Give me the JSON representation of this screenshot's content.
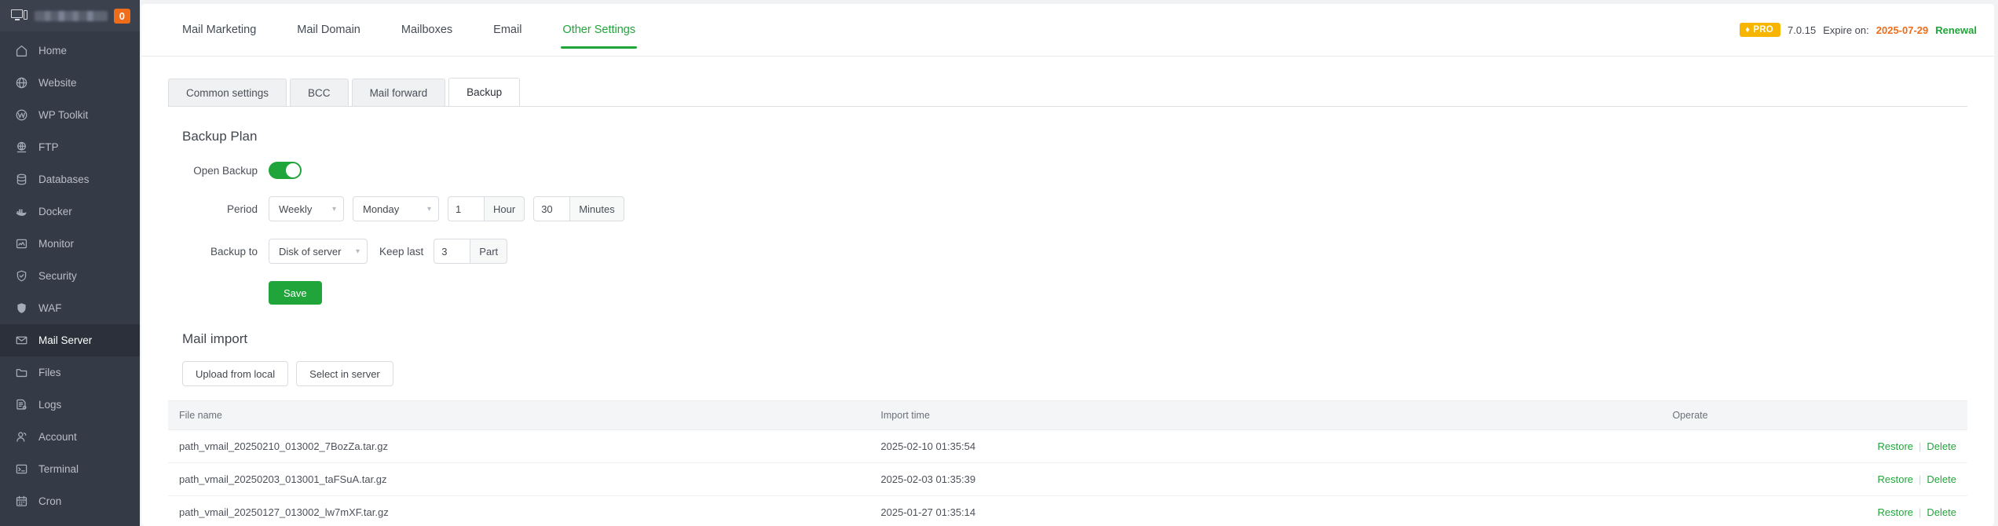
{
  "sidebar": {
    "badge": "0",
    "items": [
      {
        "label": "Home",
        "icon": "home-icon",
        "active": false
      },
      {
        "label": "Website",
        "icon": "globe-icon",
        "active": false
      },
      {
        "label": "WP Toolkit",
        "icon": "wordpress-icon",
        "active": false
      },
      {
        "label": "FTP",
        "icon": "ftp-globe-icon",
        "active": false
      },
      {
        "label": "Databases",
        "icon": "database-icon",
        "active": false
      },
      {
        "label": "Docker",
        "icon": "docker-icon",
        "active": false
      },
      {
        "label": "Monitor",
        "icon": "monitor-chart-icon",
        "active": false
      },
      {
        "label": "Security",
        "icon": "shield-check-icon",
        "active": false
      },
      {
        "label": "WAF",
        "icon": "shield-icon",
        "active": false
      },
      {
        "label": "Mail Server",
        "icon": "envelope-icon",
        "active": true
      },
      {
        "label": "Files",
        "icon": "folder-icon",
        "active": false
      },
      {
        "label": "Logs",
        "icon": "logs-icon",
        "active": false
      },
      {
        "label": "Account",
        "icon": "user-icon",
        "active": false
      },
      {
        "label": "Terminal",
        "icon": "terminal-icon",
        "active": false
      },
      {
        "label": "Cron",
        "icon": "calendar-icon",
        "active": false
      }
    ]
  },
  "topbar": {
    "tabs": [
      {
        "label": "Mail Marketing",
        "active": false
      },
      {
        "label": "Mail Domain",
        "active": false
      },
      {
        "label": "Mailboxes",
        "active": false
      },
      {
        "label": "Email",
        "active": false
      },
      {
        "label": "Other Settings",
        "active": true
      }
    ],
    "pro_label": "PRO",
    "pro_icon": "gem-icon",
    "version": "7.0.15",
    "expire_label": "Expire on:",
    "expire_date": "2025-07-29",
    "renewal_label": "Renewal"
  },
  "subtabs": [
    {
      "label": "Common settings",
      "active": false
    },
    {
      "label": "BCC",
      "active": false
    },
    {
      "label": "Mail forward",
      "active": false
    },
    {
      "label": "Backup",
      "active": true
    }
  ],
  "backup_plan": {
    "title": "Backup Plan",
    "open_backup_label": "Open Backup",
    "open_backup_on": true,
    "period_label": "Period",
    "period_value": "Weekly",
    "day_value": "Monday",
    "hour_value": "1",
    "hour_unit": "Hour",
    "minute_value": "30",
    "minute_unit": "Minutes",
    "backup_to_label": "Backup to",
    "backup_to_value": "Disk of server",
    "keep_last_label": "Keep last",
    "keep_last_value": "3",
    "keep_last_unit": "Part",
    "save_label": "Save"
  },
  "mail_import": {
    "title": "Mail import",
    "upload_label": "Upload from local",
    "select_server_label": "Select in server",
    "columns": {
      "file_name": "File name",
      "import_time": "Import time",
      "operate": "Operate"
    },
    "actions": {
      "restore": "Restore",
      "delete": "Delete"
    },
    "rows": [
      {
        "file_name": "path_vmail_20250210_013002_7BozZa.tar.gz",
        "import_time": "2025-02-10 01:35:54"
      },
      {
        "file_name": "path_vmail_20250203_013001_taFSuA.tar.gz",
        "import_time": "2025-02-03 01:35:39"
      },
      {
        "file_name": "path_vmail_20250127_013002_lw7mXF.tar.gz",
        "import_time": "2025-01-27 01:35:14"
      }
    ]
  },
  "colors": {
    "accent_green": "#20a53a",
    "badge_orange": "#ef6c1a",
    "pro_amber": "#f7b500",
    "sidebar_bg": "#343a46"
  }
}
